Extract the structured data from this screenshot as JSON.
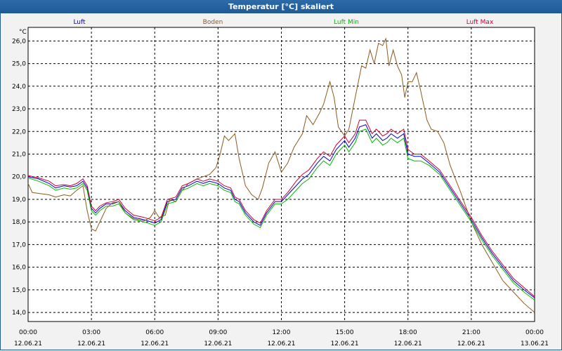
{
  "window": {
    "title": "Temperatur [°C] skaliert"
  },
  "chart_data": {
    "type": "line",
    "title": "Temperatur [°C] skaliert",
    "ylabel": "°C",
    "xlabel": "",
    "ylim": [
      13.6,
      26.6
    ],
    "xlim": [
      0,
      24
    ],
    "grid": true,
    "legend_position": "top",
    "y_ticks": [
      "14,0",
      "15,0",
      "16,0",
      "17,0",
      "18,0",
      "19,0",
      "20,0",
      "21,0",
      "22,0",
      "23,0",
      "24,0",
      "25,0",
      "26,0"
    ],
    "x_ticks": [
      {
        "time": "00:00",
        "date": "12.06.21"
      },
      {
        "time": "03:00",
        "date": "12.06.21"
      },
      {
        "time": "06:00",
        "date": "12.06.21"
      },
      {
        "time": "09:00",
        "date": "12.06.21"
      },
      {
        "time": "12:00",
        "date": "12.06.21"
      },
      {
        "time": "15:00",
        "date": "12.06.21"
      },
      {
        "time": "18:00",
        "date": "12.06.21"
      },
      {
        "time": "21:00",
        "date": "12.06.21"
      },
      {
        "time": "00:00",
        "date": "13.06.21"
      }
    ],
    "series": [
      {
        "name": "Luft",
        "color": "#0000cc",
        "points": [
          [
            0,
            20.0
          ],
          [
            0.5,
            19.9
          ],
          [
            1,
            19.7
          ],
          [
            1.3,
            19.5
          ],
          [
            1.7,
            19.6
          ],
          [
            2,
            19.55
          ],
          [
            2.3,
            19.6
          ],
          [
            2.6,
            19.8
          ],
          [
            2.8,
            19.5
          ],
          [
            3.0,
            18.6
          ],
          [
            3.2,
            18.4
          ],
          [
            3.4,
            18.6
          ],
          [
            3.7,
            18.8
          ],
          [
            4,
            18.8
          ],
          [
            4.3,
            18.9
          ],
          [
            4.6,
            18.5
          ],
          [
            5,
            18.2
          ],
          [
            5.5,
            18.1
          ],
          [
            6,
            17.95
          ],
          [
            6.3,
            18.1
          ],
          [
            6.6,
            18.9
          ],
          [
            7,
            19.0
          ],
          [
            7.3,
            19.5
          ],
          [
            7.6,
            19.6
          ],
          [
            8,
            19.8
          ],
          [
            8.3,
            19.7
          ],
          [
            8.6,
            19.8
          ],
          [
            9,
            19.7
          ],
          [
            9.3,
            19.5
          ],
          [
            9.6,
            19.4
          ],
          [
            9.8,
            19.0
          ],
          [
            10,
            18.9
          ],
          [
            10.3,
            18.4
          ],
          [
            10.7,
            18.0
          ],
          [
            11.0,
            17.85
          ],
          [
            11.3,
            18.4
          ],
          [
            11.7,
            18.9
          ],
          [
            12,
            18.9
          ],
          [
            12.3,
            19.2
          ],
          [
            12.7,
            19.6
          ],
          [
            13,
            19.9
          ],
          [
            13.3,
            20.1
          ],
          [
            13.7,
            20.6
          ],
          [
            14,
            20.9
          ],
          [
            14.3,
            20.7
          ],
          [
            14.6,
            21.2
          ],
          [
            15,
            21.6
          ],
          [
            15.2,
            21.3
          ],
          [
            15.5,
            21.7
          ],
          [
            15.7,
            22.2
          ],
          [
            16,
            22.3
          ],
          [
            16.3,
            21.7
          ],
          [
            16.5,
            21.9
          ],
          [
            16.8,
            21.6
          ],
          [
            17,
            21.7
          ],
          [
            17.2,
            21.9
          ],
          [
            17.5,
            21.7
          ],
          [
            17.8,
            21.9
          ],
          [
            18,
            21.0
          ],
          [
            18.3,
            20.9
          ],
          [
            18.6,
            20.9
          ],
          [
            19,
            20.6
          ],
          [
            19.5,
            20.2
          ],
          [
            20,
            19.5
          ],
          [
            20.5,
            18.8
          ],
          [
            21,
            18.1
          ],
          [
            21.5,
            17.3
          ],
          [
            22,
            16.6
          ],
          [
            22.5,
            16.0
          ],
          [
            23,
            15.4
          ],
          [
            23.5,
            15.0
          ],
          [
            24,
            14.65
          ]
        ]
      },
      {
        "name": "Boden",
        "color": "#8b5a1e",
        "points": [
          [
            0,
            19.7
          ],
          [
            0.2,
            19.3
          ],
          [
            0.6,
            19.25
          ],
          [
            1,
            19.2
          ],
          [
            1.3,
            19.1
          ],
          [
            1.7,
            19.2
          ],
          [
            2,
            19.15
          ],
          [
            2.3,
            19.4
          ],
          [
            2.6,
            19.6
          ],
          [
            2.8,
            18.5
          ],
          [
            3.0,
            17.7
          ],
          [
            3.2,
            17.6
          ],
          [
            3.4,
            18.0
          ],
          [
            3.7,
            18.6
          ],
          [
            4,
            18.85
          ],
          [
            4.3,
            18.9
          ],
          [
            4.6,
            18.4
          ],
          [
            5,
            18.15
          ],
          [
            5.5,
            18.05
          ],
          [
            5.8,
            18.2
          ],
          [
            6,
            18.5
          ],
          [
            6.2,
            18.2
          ],
          [
            6.5,
            18.3
          ],
          [
            6.7,
            19.0
          ],
          [
            7,
            18.9
          ],
          [
            7.3,
            19.4
          ],
          [
            7.6,
            19.7
          ],
          [
            8,
            19.9
          ],
          [
            8.3,
            20.0
          ],
          [
            8.6,
            20.1
          ],
          [
            8.9,
            20.4
          ],
          [
            9.1,
            21.0
          ],
          [
            9.3,
            21.8
          ],
          [
            9.5,
            21.6
          ],
          [
            9.8,
            21.9
          ],
          [
            10,
            20.8
          ],
          [
            10.3,
            19.6
          ],
          [
            10.6,
            19.2
          ],
          [
            10.9,
            19.0
          ],
          [
            11.1,
            19.5
          ],
          [
            11.4,
            20.6
          ],
          [
            11.7,
            21.1
          ],
          [
            12,
            20.2
          ],
          [
            12.3,
            20.6
          ],
          [
            12.6,
            21.3
          ],
          [
            13,
            21.9
          ],
          [
            13.2,
            22.7
          ],
          [
            13.5,
            22.3
          ],
          [
            13.8,
            22.8
          ],
          [
            14,
            23.2
          ],
          [
            14.3,
            24.2
          ],
          [
            14.5,
            23.5
          ],
          [
            14.7,
            22.2
          ],
          [
            15,
            21.8
          ],
          [
            15.2,
            22.1
          ],
          [
            15.5,
            23.5
          ],
          [
            15.8,
            24.9
          ],
          [
            16,
            24.8
          ],
          [
            16.2,
            25.6
          ],
          [
            16.4,
            25.0
          ],
          [
            16.6,
            25.9
          ],
          [
            16.8,
            25.8
          ],
          [
            16.95,
            26.1
          ],
          [
            17.1,
            24.9
          ],
          [
            17.3,
            25.6
          ],
          [
            17.5,
            24.9
          ],
          [
            17.7,
            24.5
          ],
          [
            17.85,
            23.5
          ],
          [
            18,
            24.2
          ],
          [
            18.2,
            24.2
          ],
          [
            18.4,
            24.6
          ],
          [
            18.6,
            23.8
          ],
          [
            18.9,
            22.5
          ],
          [
            19.1,
            22.1
          ],
          [
            19.4,
            22.0
          ],
          [
            19.7,
            21.5
          ],
          [
            20,
            20.5
          ],
          [
            20.5,
            19.3
          ],
          [
            21,
            18.0
          ],
          [
            21.5,
            17.0
          ],
          [
            22,
            16.2
          ],
          [
            22.5,
            15.4
          ],
          [
            23,
            14.9
          ],
          [
            23.5,
            14.4
          ],
          [
            24,
            14.0
          ]
        ]
      },
      {
        "name": "Luft Min",
        "color": "#00bb00",
        "points": [
          [
            0,
            19.95
          ],
          [
            0.5,
            19.8
          ],
          [
            1,
            19.6
          ],
          [
            1.3,
            19.4
          ],
          [
            1.7,
            19.5
          ],
          [
            2,
            19.45
          ],
          [
            2.3,
            19.5
          ],
          [
            2.6,
            19.7
          ],
          [
            2.8,
            19.4
          ],
          [
            3.0,
            18.5
          ],
          [
            3.2,
            18.3
          ],
          [
            3.4,
            18.5
          ],
          [
            3.7,
            18.7
          ],
          [
            4,
            18.7
          ],
          [
            4.3,
            18.8
          ],
          [
            4.6,
            18.4
          ],
          [
            5,
            18.1
          ],
          [
            5.5,
            18.0
          ],
          [
            6,
            17.85
          ],
          [
            6.3,
            18.0
          ],
          [
            6.6,
            18.8
          ],
          [
            7,
            18.9
          ],
          [
            7.3,
            19.4
          ],
          [
            7.6,
            19.5
          ],
          [
            8,
            19.7
          ],
          [
            8.3,
            19.6
          ],
          [
            8.6,
            19.7
          ],
          [
            9,
            19.6
          ],
          [
            9.3,
            19.4
          ],
          [
            9.6,
            19.3
          ],
          [
            9.8,
            18.9
          ],
          [
            10,
            18.8
          ],
          [
            10.3,
            18.3
          ],
          [
            10.7,
            17.9
          ],
          [
            11.0,
            17.75
          ],
          [
            11.3,
            18.3
          ],
          [
            11.7,
            18.8
          ],
          [
            12,
            18.8
          ],
          [
            12.3,
            19.0
          ],
          [
            12.7,
            19.4
          ],
          [
            13,
            19.7
          ],
          [
            13.3,
            19.9
          ],
          [
            13.7,
            20.4
          ],
          [
            14,
            20.7
          ],
          [
            14.3,
            20.5
          ],
          [
            14.6,
            21.0
          ],
          [
            15,
            21.4
          ],
          [
            15.2,
            21.1
          ],
          [
            15.5,
            21.5
          ],
          [
            15.7,
            22.0
          ],
          [
            16,
            22.1
          ],
          [
            16.3,
            21.5
          ],
          [
            16.5,
            21.7
          ],
          [
            16.8,
            21.4
          ],
          [
            17,
            21.5
          ],
          [
            17.2,
            21.7
          ],
          [
            17.5,
            21.5
          ],
          [
            17.8,
            21.7
          ],
          [
            18,
            20.8
          ],
          [
            18.3,
            20.7
          ],
          [
            18.6,
            20.7
          ],
          [
            19,
            20.5
          ],
          [
            19.5,
            20.1
          ],
          [
            20,
            19.4
          ],
          [
            20.5,
            18.7
          ],
          [
            21,
            18.0
          ],
          [
            21.5,
            17.2
          ],
          [
            22,
            16.5
          ],
          [
            22.5,
            15.9
          ],
          [
            23,
            15.3
          ],
          [
            23.5,
            14.9
          ],
          [
            24,
            14.55
          ]
        ]
      },
      {
        "name": "Luft Max",
        "color": "#cc0033",
        "points": [
          [
            0,
            20.05
          ],
          [
            0.5,
            19.95
          ],
          [
            1,
            19.8
          ],
          [
            1.3,
            19.6
          ],
          [
            1.7,
            19.65
          ],
          [
            2,
            19.6
          ],
          [
            2.3,
            19.7
          ],
          [
            2.6,
            19.9
          ],
          [
            2.8,
            19.6
          ],
          [
            3.0,
            18.7
          ],
          [
            3.2,
            18.5
          ],
          [
            3.4,
            18.7
          ],
          [
            3.7,
            18.85
          ],
          [
            4,
            18.9
          ],
          [
            4.3,
            19.0
          ],
          [
            4.6,
            18.6
          ],
          [
            5,
            18.3
          ],
          [
            5.5,
            18.2
          ],
          [
            6,
            18.05
          ],
          [
            6.3,
            18.2
          ],
          [
            6.6,
            19.0
          ],
          [
            7,
            19.1
          ],
          [
            7.3,
            19.6
          ],
          [
            7.6,
            19.7
          ],
          [
            8,
            19.9
          ],
          [
            8.3,
            19.8
          ],
          [
            8.6,
            19.9
          ],
          [
            9,
            19.8
          ],
          [
            9.3,
            19.6
          ],
          [
            9.6,
            19.5
          ],
          [
            9.8,
            19.1
          ],
          [
            10,
            19.0
          ],
          [
            10.3,
            18.5
          ],
          [
            10.7,
            18.1
          ],
          [
            11.0,
            17.95
          ],
          [
            11.3,
            18.5
          ],
          [
            11.7,
            19.0
          ],
          [
            12,
            19.0
          ],
          [
            12.3,
            19.3
          ],
          [
            12.7,
            19.8
          ],
          [
            13,
            20.1
          ],
          [
            13.3,
            20.3
          ],
          [
            13.7,
            20.8
          ],
          [
            14,
            21.1
          ],
          [
            14.3,
            20.9
          ],
          [
            14.6,
            21.4
          ],
          [
            15,
            21.8
          ],
          [
            15.2,
            21.5
          ],
          [
            15.5,
            21.9
          ],
          [
            15.7,
            22.5
          ],
          [
            16,
            22.5
          ],
          [
            16.3,
            21.9
          ],
          [
            16.5,
            22.1
          ],
          [
            16.8,
            21.8
          ],
          [
            17,
            21.9
          ],
          [
            17.2,
            22.1
          ],
          [
            17.5,
            21.9
          ],
          [
            17.8,
            22.1
          ],
          [
            18,
            21.2
          ],
          [
            18.3,
            21.0
          ],
          [
            18.6,
            21.0
          ],
          [
            19,
            20.7
          ],
          [
            19.5,
            20.3
          ],
          [
            20,
            19.6
          ],
          [
            20.5,
            18.9
          ],
          [
            21,
            18.2
          ],
          [
            21.5,
            17.4
          ],
          [
            22,
            16.7
          ],
          [
            22.5,
            16.1
          ],
          [
            23,
            15.5
          ],
          [
            23.5,
            15.1
          ],
          [
            24,
            14.7
          ]
        ]
      }
    ]
  }
}
